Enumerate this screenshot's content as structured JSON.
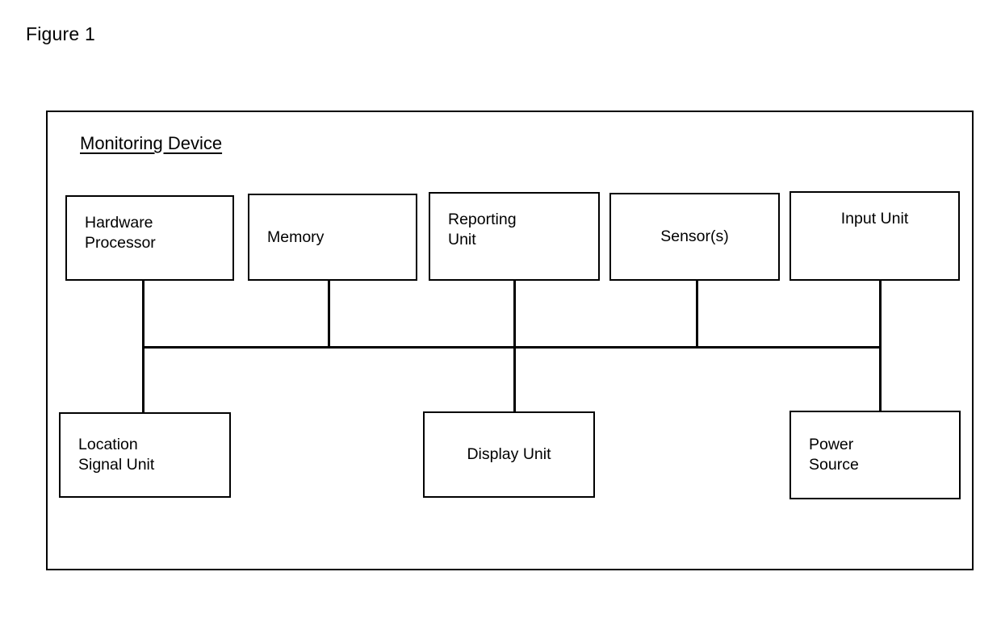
{
  "figure": {
    "caption": "Figure 1",
    "device_title": "Monitoring Device",
    "line_color": "#000000",
    "background_color": "#ffffff"
  },
  "diagram_data": {
    "type": "block-diagram",
    "title": "Figure 1",
    "container_label": "Monitoring Device",
    "top_row": [
      {
        "id": "hardware-processor",
        "label": "Hardware\nProcessor"
      },
      {
        "id": "memory",
        "label": "Memory"
      },
      {
        "id": "reporting-unit",
        "label": "Reporting\nUnit"
      },
      {
        "id": "sensors",
        "label": "Sensor(s)"
      },
      {
        "id": "input-unit",
        "label": "Input Unit"
      }
    ],
    "bottom_row": [
      {
        "id": "location-signal-unit",
        "label": "Location\nSignal Unit"
      },
      {
        "id": "display-unit",
        "label": "Display Unit"
      },
      {
        "id": "power-source",
        "label": "Power\nSource"
      }
    ],
    "connections": [
      {
        "from": "hardware-processor",
        "to": "bus"
      },
      {
        "from": "memory",
        "to": "bus"
      },
      {
        "from": "reporting-unit",
        "to": "bus"
      },
      {
        "from": "sensors",
        "to": "bus"
      },
      {
        "from": "input-unit",
        "to": "bus"
      },
      {
        "from": "bus",
        "to": "location-signal-unit"
      },
      {
        "from": "bus",
        "to": "display-unit"
      },
      {
        "from": "bus",
        "to": "power-source"
      }
    ]
  },
  "blocks": {
    "hardware_processor": {
      "label": "Hardware\nProcessor"
    },
    "memory": {
      "label": "Memory"
    },
    "reporting_unit": {
      "label": "Reporting\nUnit"
    },
    "sensors": {
      "label": "Sensor(s)"
    },
    "input_unit": {
      "label": "Input Unit"
    },
    "location_signal_unit": {
      "label": "Location\nSignal Unit"
    },
    "display_unit": {
      "label": "Display Unit"
    },
    "power_source": {
      "label": "Power\nSource"
    }
  }
}
